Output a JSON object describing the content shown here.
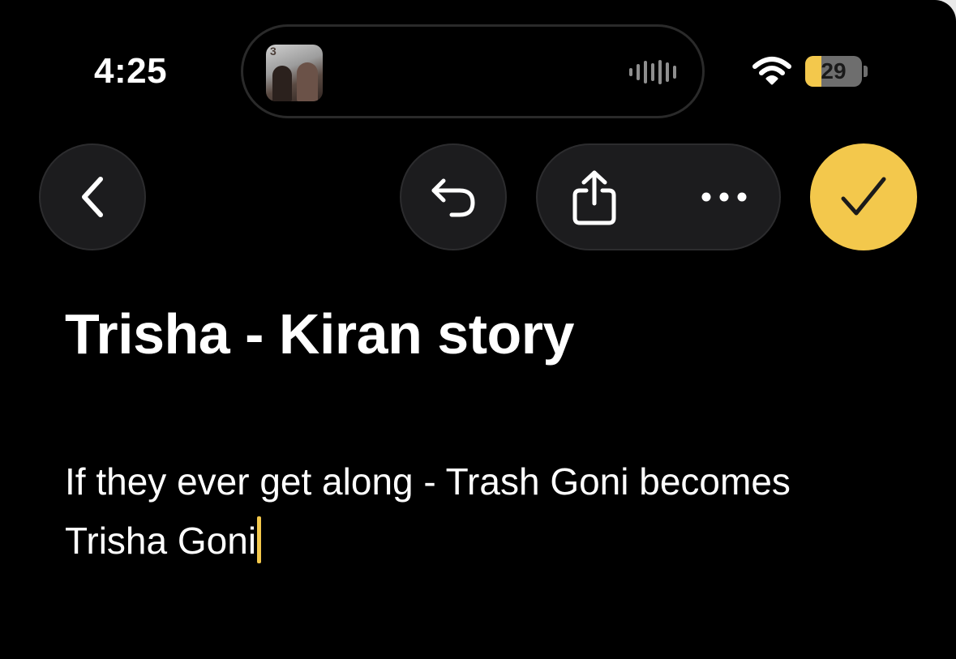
{
  "status_bar": {
    "time": "4:25",
    "battery_level": "29",
    "battery_fraction": 0.29,
    "accent_color": "#f3c84c",
    "icons": [
      "wifi-icon",
      "battery-icon"
    ]
  },
  "dynamic_island": {
    "artwork_icon": "album-artwork",
    "artwork_number": "3",
    "waveform_icon": "audio-waveform-icon"
  },
  "toolbar": {
    "back_icon": "chevron-left-icon",
    "undo_icon": "undo-arrow-icon",
    "share_icon": "share-icon",
    "more_icon": "ellipsis-icon",
    "done_icon": "checkmark-icon",
    "done_color": "#f3c84c"
  },
  "note": {
    "title": "Trisha - Kiran story",
    "body": "If they ever get along - Trash Goni becomes Trisha Goni"
  }
}
